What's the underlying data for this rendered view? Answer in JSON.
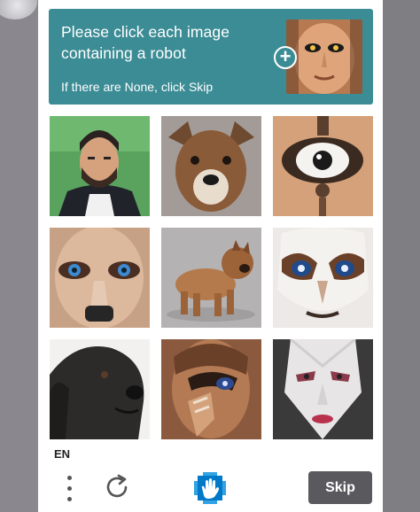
{
  "captcha": {
    "prompt": "Please click each image containing a robot",
    "subprompt": "If there are None, click Skip",
    "reference_image": "robot-face-reference",
    "add_icon": "plus-icon"
  },
  "grid": {
    "tiles": [
      {
        "subject": "man-with-beard"
      },
      {
        "subject": "dog-face"
      },
      {
        "subject": "robot-eye"
      },
      {
        "subject": "robot-face-blue-eyes"
      },
      {
        "subject": "bulldog-standing"
      },
      {
        "subject": "robot-mask-blue-eyes"
      },
      {
        "subject": "black-labrador"
      },
      {
        "subject": "robot-face-copper"
      },
      {
        "subject": "robot-face-white"
      }
    ]
  },
  "footer": {
    "language": "EN",
    "menu_icon": "more-vertical-icon",
    "refresh_icon": "refresh-icon",
    "logo_icon": "hand-logo-icon",
    "skip_label": "Skip"
  },
  "colors": {
    "header": "#3c8c95",
    "skip_button": "#5a5a5e",
    "card": "#ffffff"
  }
}
